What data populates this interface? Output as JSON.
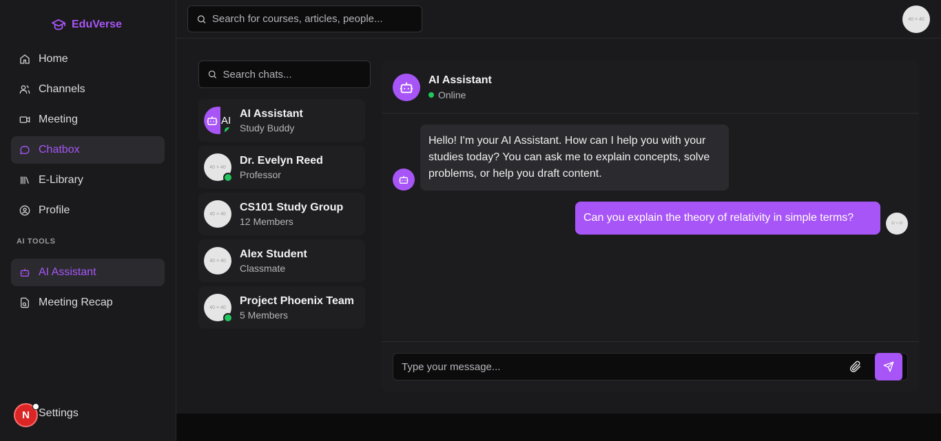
{
  "brand": {
    "name": "EduVerse"
  },
  "nav": [
    {
      "label": "Home",
      "icon": "home-icon"
    },
    {
      "label": "Channels",
      "icon": "users-icon"
    },
    {
      "label": "Meeting",
      "icon": "video-icon"
    },
    {
      "label": "Chatbox",
      "icon": "message-icon",
      "active": true
    },
    {
      "label": "E-Library",
      "icon": "library-icon"
    },
    {
      "label": "Profile",
      "icon": "user-circle-icon"
    }
  ],
  "ai_tools": {
    "section_label": "AI TOOLS",
    "items": [
      {
        "label": "AI Assistant",
        "icon": "bot-icon",
        "active": true
      },
      {
        "label": "Meeting Recap",
        "icon": "recap-icon"
      }
    ]
  },
  "settings": {
    "label": "Settings"
  },
  "user": {
    "initial": "N"
  },
  "topbar": {
    "search_placeholder": "Search for courses, articles, people...",
    "avatar_placeholder": "40 × 40"
  },
  "chat_list": {
    "search_placeholder": "Search chats...",
    "items": [
      {
        "name": "AI Assistant",
        "subtitle": "Study Buddy",
        "avatar_text": "AI",
        "online": true
      },
      {
        "name": "Dr. Evelyn Reed",
        "subtitle": "Professor",
        "avatar_text": "40 × 40",
        "online": true
      },
      {
        "name": "CS101 Study Group",
        "subtitle": "12 Members",
        "avatar_text": "40 × 40",
        "online": false
      },
      {
        "name": "Alex Student",
        "subtitle": "Classmate",
        "avatar_text": "40 × 40",
        "online": false
      },
      {
        "name": "Project Phoenix Team",
        "subtitle": "5 Members",
        "avatar_text": "40 × 40",
        "online": true
      }
    ]
  },
  "conversation": {
    "name": "AI Assistant",
    "status": "Online",
    "messages": [
      {
        "from": "bot",
        "text": "Hello! I'm your AI Assistant. How can I help you with your studies today? You can ask me to explain concepts, solve problems, or help you draft content."
      },
      {
        "from": "user",
        "text": "Can you explain the theory of relativity in simple terms?",
        "avatar_text": "32 × 32"
      }
    ],
    "composer_placeholder": "Type your message..."
  },
  "colors": {
    "accent": "#a855f7",
    "online": "#22c55e",
    "background": "#1a1a1c"
  }
}
